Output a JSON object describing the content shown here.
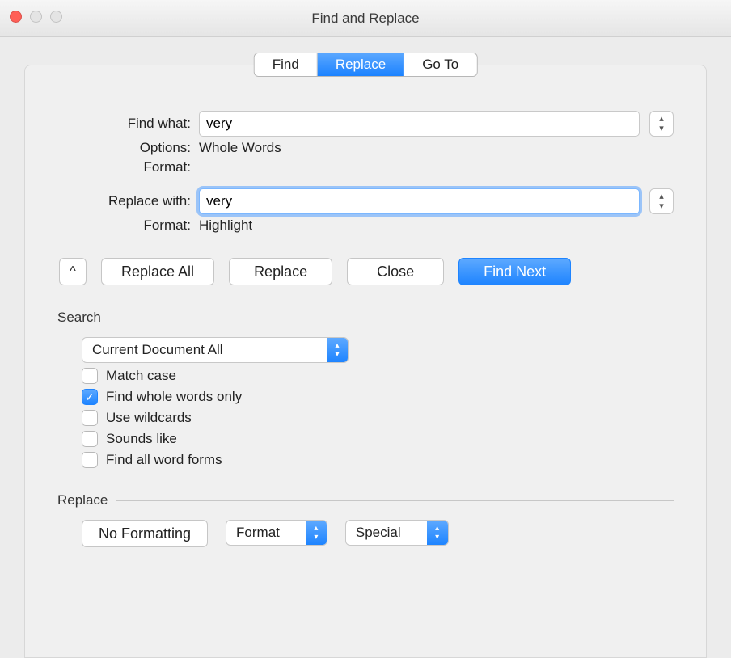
{
  "window": {
    "title": "Find and Replace"
  },
  "tabs": [
    {
      "label": "Find",
      "active": false
    },
    {
      "label": "Replace",
      "active": true
    },
    {
      "label": "Go To",
      "active": false
    }
  ],
  "find": {
    "label": "Find what:",
    "value": "very",
    "options_label": "Options:",
    "options_value": "Whole Words",
    "format_label": "Format:",
    "format_value": ""
  },
  "replace": {
    "label": "Replace with:",
    "value": "very",
    "format_label": "Format:",
    "format_value": "Highlight"
  },
  "buttons": {
    "collapse_glyph": "^",
    "replace_all": "Replace All",
    "replace": "Replace",
    "close": "Close",
    "find_next": "Find Next"
  },
  "search": {
    "title": "Search",
    "scope": "Current Document All",
    "match_case": {
      "label": "Match case",
      "checked": false
    },
    "whole_words": {
      "label": "Find whole words only",
      "checked": true
    },
    "wildcards": {
      "label": "Use wildcards",
      "checked": false
    },
    "sounds_like": {
      "label": "Sounds like",
      "checked": false
    },
    "word_forms": {
      "label": "Find all word forms",
      "checked": false
    }
  },
  "replace_section": {
    "title": "Replace",
    "no_formatting": "No Formatting",
    "format": "Format",
    "special": "Special"
  }
}
